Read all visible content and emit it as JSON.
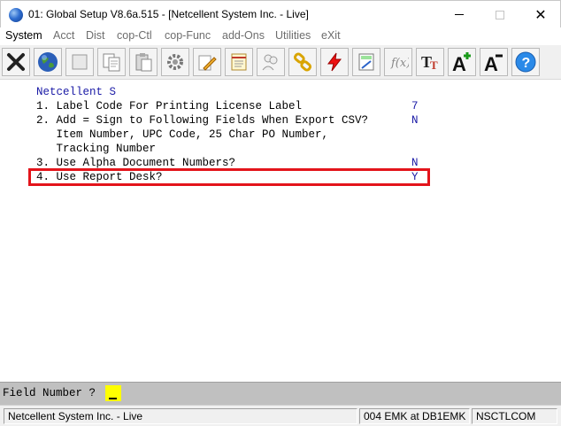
{
  "window": {
    "title": "01: Global Setup V8.6a.515 - [Netcellent System Inc. - Live]"
  },
  "menu": {
    "items": [
      "System",
      "Acct",
      "Dist",
      "cop-Ctl",
      "cop-Func",
      "add-Ons",
      "Utilities",
      "eXit"
    ]
  },
  "toolbar": {
    "icons": [
      "close-x-icon",
      "globe-icon",
      "blank-icon",
      "copy-icon",
      "paste-icon",
      "settings-icon",
      "edit-icon",
      "notepad-icon",
      "users-icon",
      "chain-link-icon",
      "lightning-icon",
      "calculator-icon",
      "function-icon",
      "font-icon",
      "font-increase-icon",
      "font-decrease-icon",
      "help-icon"
    ]
  },
  "terminal": {
    "header": "Netcellent S",
    "lines": [
      {
        "label": "1. Label Code For Printing License Label",
        "value": "7"
      },
      {
        "label": "2. Add = Sign to Following Fields When Export CSV?",
        "value": "N"
      },
      {
        "label": "   Item Number, UPC Code, 25 Char PO Number,",
        "value": ""
      },
      {
        "label": "   Tracking Number",
        "value": ""
      },
      {
        "label": "3. Use Alpha Document Numbers?",
        "value": "N"
      },
      {
        "label": "4. Use Report Desk?",
        "value": "Y"
      }
    ],
    "highlight_color": "#e3141b"
  },
  "prompt": {
    "label": "Field Number ? ",
    "value": "_"
  },
  "status": {
    "company": "Netcellent System Inc. - Live",
    "user": "004 EMK at DB1EMK",
    "database": "NSCTLCOM"
  }
}
